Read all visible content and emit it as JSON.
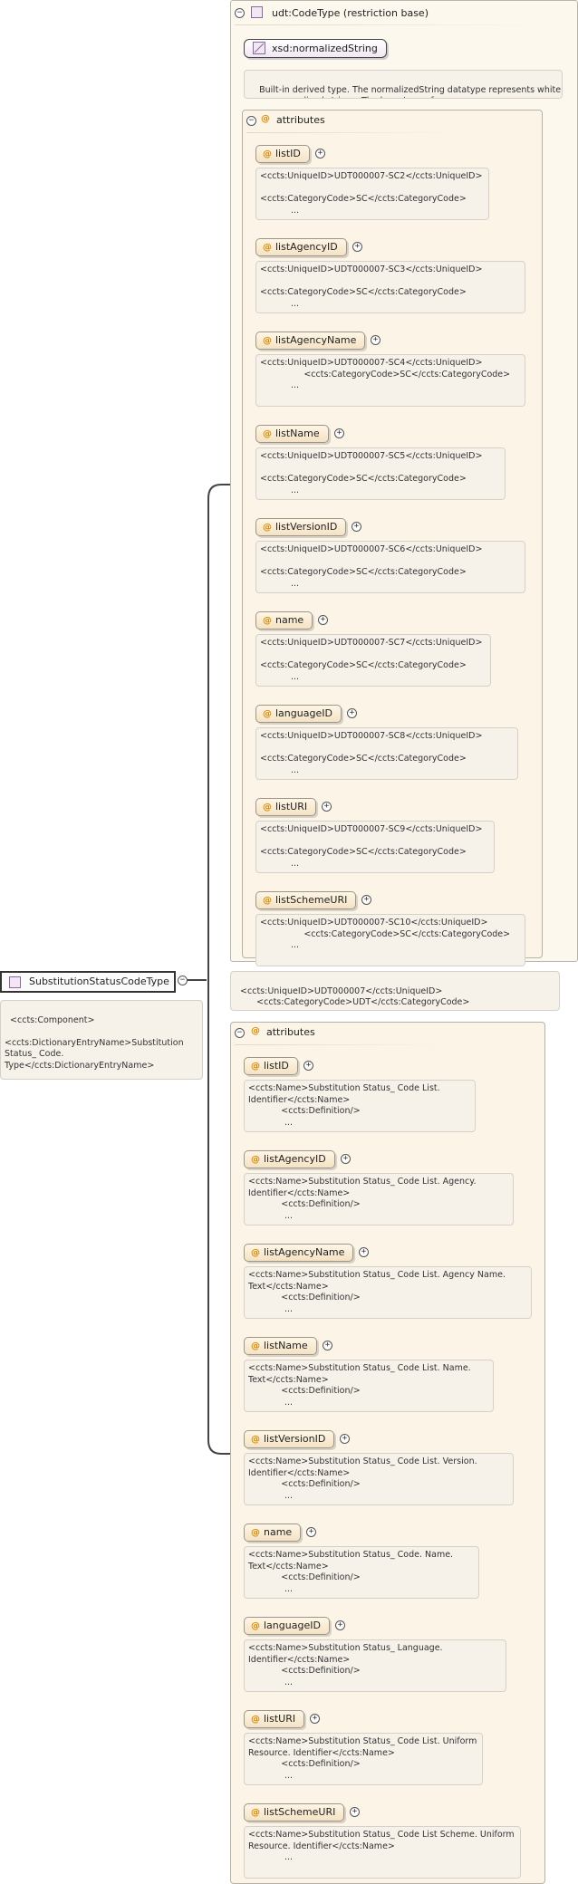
{
  "root": {
    "name": "SubstitutionStatusCodeType",
    "annotation": "<ccts:Component>\n\n<ccts:DictionaryEntryName>Substitution\nStatus_ Code.\nType</ccts:DictionaryEntryName>",
    "annotation_more": "..."
  },
  "base_type": {
    "title": "udt:CodeType (restriction base)",
    "xsd_type": "xsd:normalizedString",
    "xsd_description": "Built-in derived type. The normalizedString datatype represents white\nspace normalized strings. The base type of...",
    "attributes_label": "attributes",
    "attributes": [
      {
        "name": "listID",
        "doc": "<ccts:UniqueID>UDT000007-SC2</ccts:UniqueID>\n\n<ccts:CategoryCode>SC</ccts:CategoryCode>"
      },
      {
        "name": "listAgencyID",
        "doc": "<ccts:UniqueID>UDT000007-SC3</ccts:UniqueID>\n\n<ccts:CategoryCode>SC</ccts:CategoryCode>"
      },
      {
        "name": "listAgencyName",
        "doc": "<ccts:UniqueID>UDT000007-SC4</ccts:UniqueID>\n                <ccts:CategoryCode>SC</ccts:CategoryCode>"
      },
      {
        "name": "listName",
        "doc": "<ccts:UniqueID>UDT000007-SC5</ccts:UniqueID>\n\n<ccts:CategoryCode>SC</ccts:CategoryCode>"
      },
      {
        "name": "listVersionID",
        "doc": "<ccts:UniqueID>UDT000007-SC6</ccts:UniqueID>\n\n<ccts:CategoryCode>SC</ccts:CategoryCode>"
      },
      {
        "name": "name",
        "doc": "<ccts:UniqueID>UDT000007-SC7</ccts:UniqueID>\n\n<ccts:CategoryCode>SC</ccts:CategoryCode>"
      },
      {
        "name": "languageID",
        "doc": "<ccts:UniqueID>UDT000007-SC8</ccts:UniqueID>\n\n<ccts:CategoryCode>SC</ccts:CategoryCode>"
      },
      {
        "name": "listURI",
        "doc": "<ccts:UniqueID>UDT000007-SC9</ccts:UniqueID>\n\n<ccts:CategoryCode>SC</ccts:CategoryCode>"
      },
      {
        "name": "listSchemeURI",
        "doc": "<ccts:UniqueID>UDT000007-SC10</ccts:UniqueID>\n                <ccts:CategoryCode>SC</ccts:CategoryCode>"
      }
    ]
  },
  "type_annotation": "<ccts:UniqueID>UDT000007</ccts:UniqueID>\n        <ccts:CategoryCode>UDT</ccts:CategoryCode>",
  "type_annotation_more": "...",
  "attributes_label": "attributes",
  "attributes": [
    {
      "name": "listID",
      "doc": "<ccts:Name>Substitution Status_ Code List.\nIdentifier</ccts:Name>\n            <ccts:Definition/>"
    },
    {
      "name": "listAgencyID",
      "doc": "<ccts:Name>Substitution Status_ Code List. Agency.\nIdentifier</ccts:Name>\n            <ccts:Definition/>"
    },
    {
      "name": "listAgencyName",
      "doc": "<ccts:Name>Substitution Status_ Code List. Agency Name.\nText</ccts:Name>\n            <ccts:Definition/>"
    },
    {
      "name": "listName",
      "doc": "<ccts:Name>Substitution Status_ Code List. Name.\nText</ccts:Name>\n            <ccts:Definition/>"
    },
    {
      "name": "listVersionID",
      "doc": "<ccts:Name>Substitution Status_ Code List. Version.\nIdentifier</ccts:Name>\n            <ccts:Definition/>"
    },
    {
      "name": "name",
      "doc": "<ccts:Name>Substitution Status_ Code. Name.\nText</ccts:Name>\n            <ccts:Definition/>"
    },
    {
      "name": "languageID",
      "doc": "<ccts:Name>Substitution Status_ Language.\nIdentifier</ccts:Name>\n            <ccts:Definition/>"
    },
    {
      "name": "listURI",
      "doc": "<ccts:Name>Substitution Status_ Code List. Uniform\nResource. Identifier</ccts:Name>\n            <ccts:Definition/>"
    },
    {
      "name": "listSchemeURI",
      "doc": "<ccts:Name>Substitution Status_ Code List Scheme. Uniform\nResource. Identifier</ccts:Name>"
    }
  ],
  "more": "..."
}
